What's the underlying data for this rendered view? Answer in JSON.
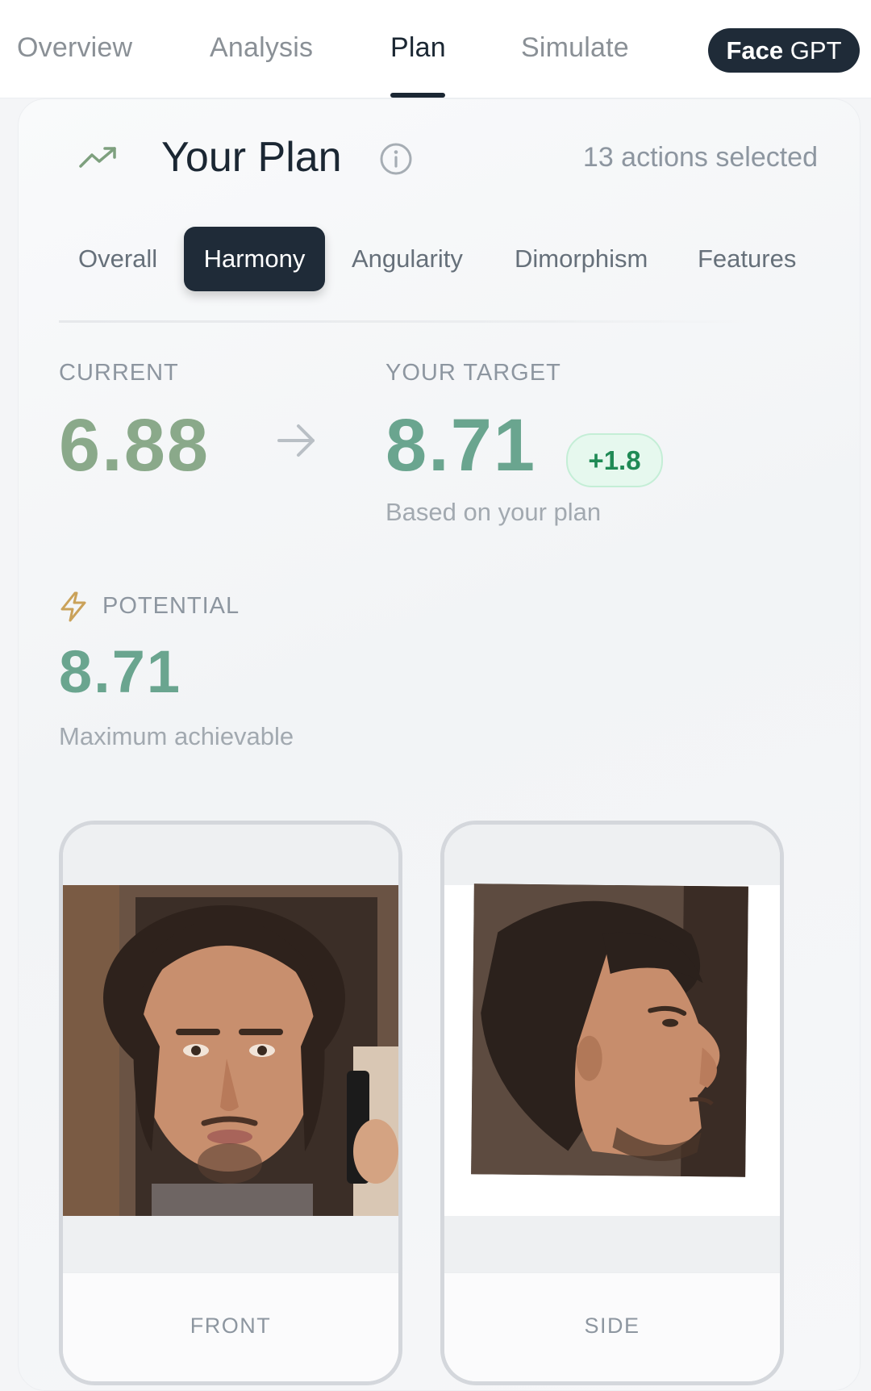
{
  "topnav": {
    "tabs": [
      {
        "label": "Overview"
      },
      {
        "label": "Analysis"
      },
      {
        "label": "Plan"
      },
      {
        "label": "Simulate"
      }
    ],
    "active_tab": "Plan",
    "face_button": {
      "bold": "Face",
      "light": "GPT"
    }
  },
  "plan": {
    "title": "Your Plan",
    "actions_selected": "13 actions selected",
    "subtabs": [
      {
        "label": "Overall"
      },
      {
        "label": "Harmony"
      },
      {
        "label": "Angularity"
      },
      {
        "label": "Dimorphism"
      },
      {
        "label": "Features"
      }
    ],
    "active_subtab": "Harmony"
  },
  "scores": {
    "current_label": "CURRENT",
    "current_value": "6.88",
    "target_label": "YOUR TARGET",
    "target_value": "8.71",
    "delta": "+1.8",
    "target_note": "Based on your plan",
    "potential_label": "POTENTIAL",
    "potential_value": "8.71",
    "potential_note": "Maximum achievable"
  },
  "photos": {
    "front_caption": "FRONT",
    "side_caption": "SIDE"
  },
  "colors": {
    "current": "#8aa98a",
    "target": "#6aa58f",
    "delta_text": "#1f8a55",
    "dark": "#1f2b38",
    "bolt": "#caa25a"
  },
  "icons": [
    "trend-up-icon",
    "info-icon",
    "arrow-right-icon",
    "bolt-icon"
  ]
}
